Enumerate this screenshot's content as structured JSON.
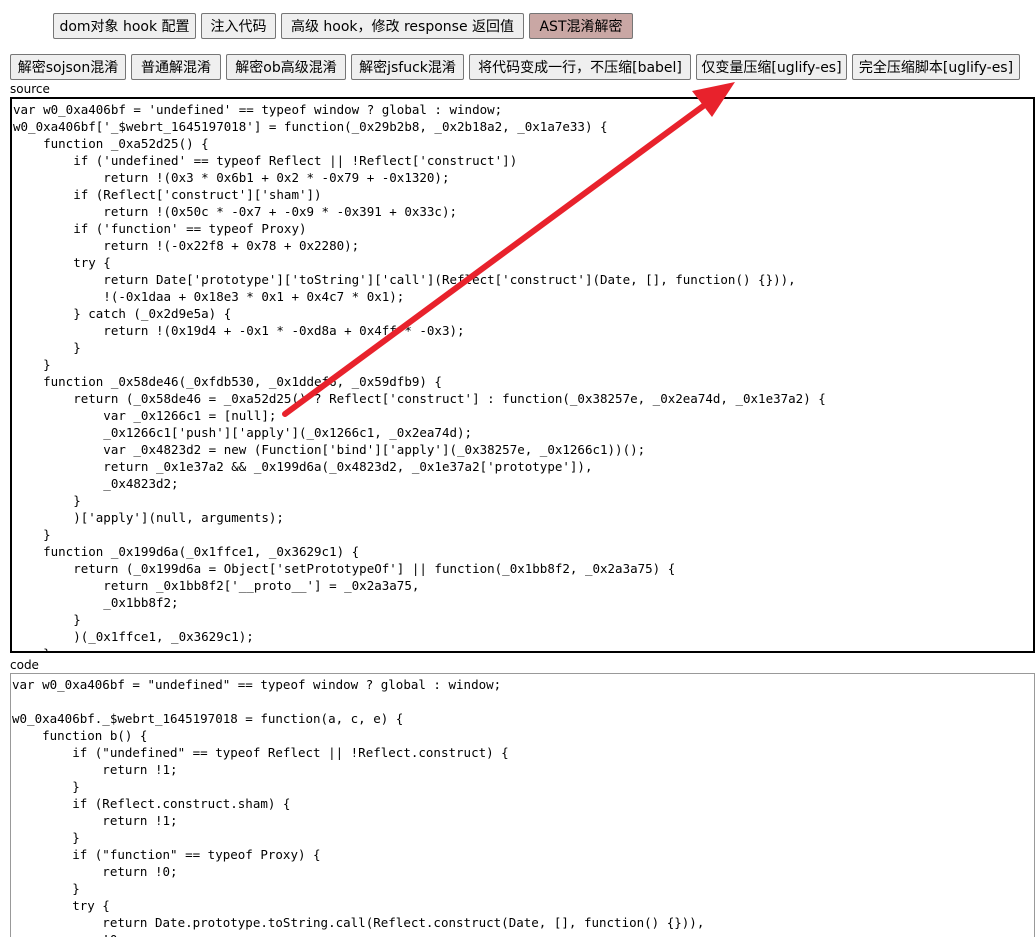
{
  "top_toolbar": {
    "buttons": [
      {
        "label": "dom对象 hook 配置"
      },
      {
        "label": "注入代码"
      },
      {
        "label": "高级 hook，修改 response 返回值"
      },
      {
        "label": "AST混淆解密"
      }
    ]
  },
  "decode_toolbar": {
    "buttons": [
      {
        "label": "解密sojson混淆"
      },
      {
        "label": "普通解混淆"
      },
      {
        "label": "解密ob高级混淆"
      },
      {
        "label": "解密jsfuck混淆"
      },
      {
        "label": "将代码变成一行，不压缩[babel]"
      },
      {
        "label": "仅变量压缩[uglify-es]"
      },
      {
        "label": "完全压缩脚本[uglify-es]"
      }
    ]
  },
  "source": {
    "label": "source",
    "code": "var w0_0xa406bf = 'undefined' == typeof window ? global : window;\nw0_0xa406bf['_$webrt_1645197018'] = function(_0x29b2b8, _0x2b18a2, _0x1a7e33) {\n    function _0xa52d25() {\n        if ('undefined' == typeof Reflect || !Reflect['construct'])\n            return !(0x3 * 0x6b1 + 0x2 * -0x79 + -0x1320);\n        if (Reflect['construct']['sham'])\n            return !(0x50c * -0x7 + -0x9 * -0x391 + 0x33c);\n        if ('function' == typeof Proxy)\n            return !(-0x22f8 + 0x78 + 0x2280);\n        try {\n            return Date['prototype']['toString']['call'](Reflect['construct'](Date, [], function() {})),\n            !(-0x1daa + 0x18e3 * 0x1 + 0x4c7 * 0x1);\n        } catch (_0x2d9e5a) {\n            return !(0x19d4 + -0x1 * -0xd8a + 0x4ff * -0x3);\n        }\n    }\n    function _0x58de46(_0xfdb530, _0x1ddef6, _0x59dfb9) {\n        return (_0x58de46 = _0xa52d25() ? Reflect['construct'] : function(_0x38257e, _0x2ea74d, _0x1e37a2) {\n            var _0x1266c1 = [null];\n            _0x1266c1['push']['apply'](_0x1266c1, _0x2ea74d);\n            var _0x4823d2 = new (Function['bind']['apply'](_0x38257e, _0x1266c1))();\n            return _0x1e37a2 && _0x199d6a(_0x4823d2, _0x1e37a2['prototype']),\n            _0x4823d2;\n        }\n        )['apply'](null, arguments);\n    }\n    function _0x199d6a(_0x1ffce1, _0x3629c1) {\n        return (_0x199d6a = Object['setPrototypeOf'] || function(_0x1bb8f2, _0x2a3a75) {\n            return _0x1bb8f2['__proto__'] = _0x2a3a75,\n            _0x1bb8f2;\n        }\n        )(_0x1ffce1, _0x3629c1);\n    }"
  },
  "output": {
    "label": "code",
    "code": "var w0_0xa406bf = \"undefined\" == typeof window ? global : window;\n\nw0_0xa406bf._$webrt_1645197018 = function(a, c, e) {\n    function b() {\n        if (\"undefined\" == typeof Reflect || !Reflect.construct) {\n            return !1;\n        }\n        if (Reflect.construct.sham) {\n            return !1;\n        }\n        if (\"function\" == typeof Proxy) {\n            return !0;\n        }\n        try {\n            return Date.prototype.toString.call(Reflect.construct(Date, [], function() {})),\n            !0;"
  },
  "colors": {
    "active_button": "#c9a7a4",
    "annotation_arrow": "#e8222c"
  }
}
